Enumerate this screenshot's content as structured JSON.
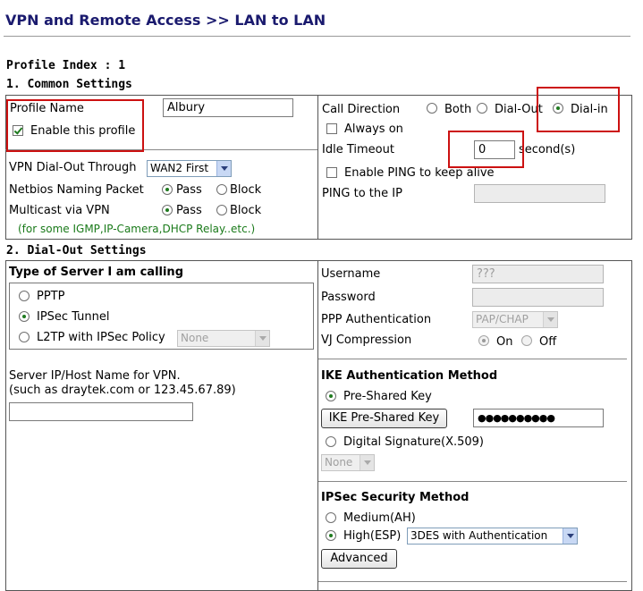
{
  "page": {
    "title": "VPN and Remote Access >> LAN to LAN",
    "profile_index": "Profile Index : 1"
  },
  "common": {
    "heading": "1. Common Settings",
    "profile_name_label": "Profile Name",
    "profile_name_value": "Albury",
    "enable_profile_label": "Enable this profile",
    "enable_profile_checked": true,
    "dialout_through_label": "VPN Dial-Out Through",
    "dialout_through_value": "WAN2 First",
    "netbios_label": "Netbios Naming Packet",
    "multicast_label": "Multicast via VPN",
    "pass_label": "Pass",
    "block_label": "Block",
    "note": "(for some IGMP,IP-Camera,DHCP Relay..etc.)",
    "call_direction_label": "Call Direction",
    "both_label": "Both",
    "dialout_label": "Dial-Out",
    "dialin_label": "Dial-in",
    "always_on_label": "Always on",
    "idle_timeout_label": "Idle Timeout",
    "idle_timeout_value": "0",
    "seconds_label": "second(s)",
    "enable_ping_label": "Enable PING to keep alive",
    "ping_ip_label": "PING to the IP"
  },
  "dialout": {
    "heading": "2. Dial-Out Settings",
    "server_type_heading": "Type of Server I am calling",
    "pptp_label": "PPTP",
    "ipsec_label": "IPSec Tunnel",
    "l2tp_label": "L2TP with IPSec Policy",
    "l2tp_policy_value": "None",
    "server_host_label": "Server IP/Host Name for VPN.",
    "server_host_hint": "(such as draytek.com or 123.45.67.89)",
    "username_label": "Username",
    "username_value": "???",
    "password_label": "Password",
    "ppp_auth_label": "PPP Authentication",
    "ppp_auth_value": "PAP/CHAP",
    "vj_label": "VJ Compression",
    "on_label": "On",
    "off_label": "Off",
    "ike_heading": "IKE Authentication Method",
    "preshared_label": "Pre-Shared Key",
    "ike_button": "IKE Pre-Shared Key",
    "ike_key_value": "●●●●●●●●●●",
    "digital_sig_label": "Digital Signature(X.509)",
    "digital_sig_value": "None",
    "ipsec_heading": "IPSec Security Method",
    "medium_label": "Medium(AH)",
    "high_label": "High(ESP)",
    "high_value": "3DES with Authentication",
    "advanced_button": "Advanced"
  },
  "colors": {
    "title": "#1a1a6e",
    "note": "#1a7a1a",
    "highlight": "#cc1111"
  }
}
